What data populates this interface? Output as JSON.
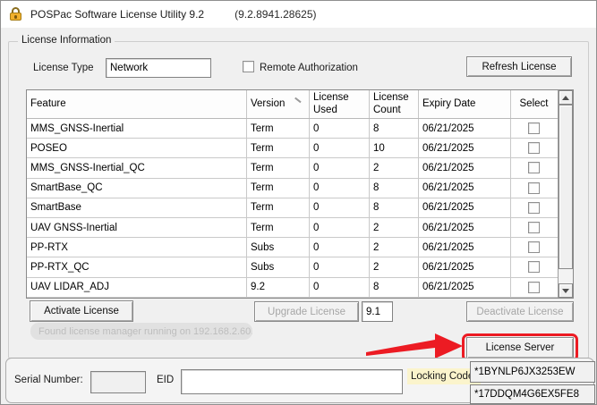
{
  "window": {
    "title": "POSPac Software License Utility 9.2",
    "build": "(9.2.8941.28625)"
  },
  "icons": {
    "titlebar": "lock-icon",
    "version_header": "sort-indicator",
    "scrollbar": [
      "scroll-up-icon",
      "scroll-down-icon"
    ],
    "eid_spinner": [
      "spinner-up-icon",
      "spinner-down-icon"
    ],
    "annotation": "red-arrow"
  },
  "license_info": {
    "group_label": "License Information",
    "license_type_label": "License Type",
    "license_type_value": "Network",
    "remote_authorization_label": "Remote Authorization",
    "remote_authorization_checked": false,
    "refresh_button": "Refresh License"
  },
  "table": {
    "columns": [
      "Feature",
      "Version",
      "License Used",
      "License Count",
      "Expiry Date",
      "Select"
    ],
    "rows": [
      {
        "feature": "MMS_GNSS-Inertial",
        "version": "Term",
        "used": "0",
        "count": "8",
        "expiry": "06/21/2025",
        "selected": false
      },
      {
        "feature": "POSEO",
        "version": "Term",
        "used": "0",
        "count": "10",
        "expiry": "06/21/2025",
        "selected": false
      },
      {
        "feature": "MMS_GNSS-Inertial_QC",
        "version": "Term",
        "used": "0",
        "count": "2",
        "expiry": "06/21/2025",
        "selected": false
      },
      {
        "feature": "SmartBase_QC",
        "version": "Term",
        "used": "0",
        "count": "8",
        "expiry": "06/21/2025",
        "selected": false
      },
      {
        "feature": "SmartBase",
        "version": "Term",
        "used": "0",
        "count": "8",
        "expiry": "06/21/2025",
        "selected": false
      },
      {
        "feature": "UAV GNSS-Inertial",
        "version": "Term",
        "used": "0",
        "count": "2",
        "expiry": "06/21/2025",
        "selected": false
      },
      {
        "feature": "PP-RTX",
        "version": "Subs",
        "used": "0",
        "count": "2",
        "expiry": "06/21/2025",
        "selected": false
      },
      {
        "feature": "PP-RTX_QC",
        "version": "Subs",
        "used": "0",
        "count": "2",
        "expiry": "06/21/2025",
        "selected": false
      },
      {
        "feature": "UAV LIDAR_ADJ",
        "version": "9.2",
        "used": "0",
        "count": "8",
        "expiry": "06/21/2025",
        "selected": false
      }
    ]
  },
  "actions": {
    "activate_button": "Activate License",
    "upgrade_button": "Upgrade License",
    "upgrade_version_value": "9.1",
    "deactivate_button": "Deactivate License",
    "license_server_button": "License Server"
  },
  "status_message": "Found license manager running on 192.168.2.60.",
  "footer": {
    "serial_label": "Serial Number:",
    "serial_value": "",
    "eid_label": "EID",
    "eid_value": "",
    "locking_code_label": "Locking Code:",
    "locking_code_1": "*1BYNLP6JX3253EW",
    "locking_code_2": "*17DDQM4G6EX5FE8"
  },
  "colors": {
    "annotation_red": "#ec1b23",
    "locking_code_highlight": "#fbf4cc",
    "dialog_background": "#f0f0f0"
  }
}
